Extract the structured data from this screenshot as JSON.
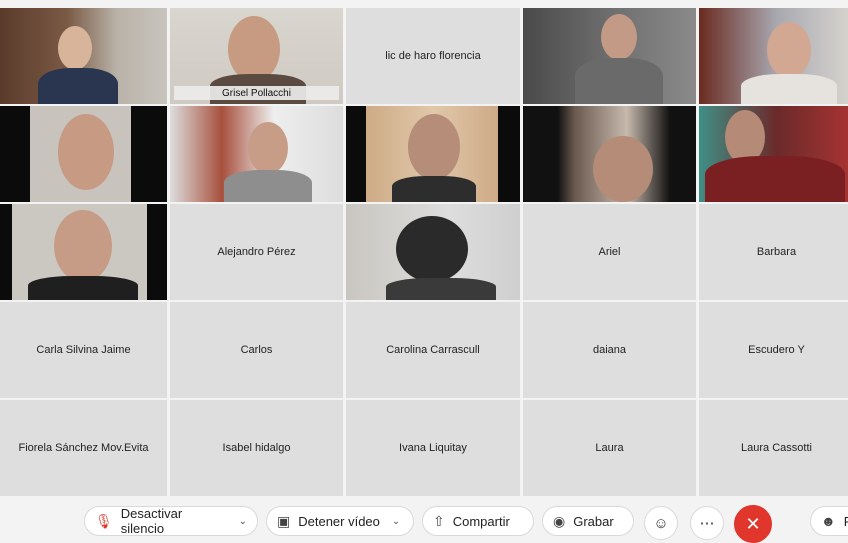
{
  "participants": [
    {
      "name": "",
      "video": true
    },
    {
      "name": "Grisel Pollacchi",
      "video": true,
      "active": true
    },
    {
      "name": "lic de haro florencia",
      "video": false
    },
    {
      "name": "",
      "video": true
    },
    {
      "name": "",
      "video": true
    },
    {
      "name": "",
      "video": true
    },
    {
      "name": "",
      "video": true
    },
    {
      "name": "",
      "video": true
    },
    {
      "name": "",
      "video": true
    },
    {
      "name": "",
      "video": true
    },
    {
      "name": "",
      "video": true
    },
    {
      "name": "Alejandro Pérez",
      "video": false
    },
    {
      "name": "",
      "video": true
    },
    {
      "name": "Ariel",
      "video": false
    },
    {
      "name": "Barbara",
      "video": false
    },
    {
      "name": "Carla Silvina Jaime",
      "video": false
    },
    {
      "name": "Carlos",
      "video": false
    },
    {
      "name": "Carolina Carrascull",
      "video": false
    },
    {
      "name": "daiana",
      "video": false
    },
    {
      "name": "Escudero Y",
      "video": false
    },
    {
      "name": "Fiorela Sánchez Mov.Evita",
      "video": false
    },
    {
      "name": "Isabel hidalgo",
      "video": false
    },
    {
      "name": "Ivana Liquitay",
      "video": false
    },
    {
      "name": "Laura",
      "video": false
    },
    {
      "name": "Laura Cassotti",
      "video": false
    }
  ],
  "toolbar": {
    "mute_label": "Desactivar silencio",
    "mute_icon": "mic-muted-icon",
    "video_label": "Detener vídeo",
    "video_icon": "camera-icon",
    "share_label": "Compartir",
    "share_icon": "share-icon",
    "record_label": "Grabar",
    "record_icon": "record-icon",
    "reactions_icon": "smiley-icon",
    "more_icon": "more-icon",
    "leave_icon": "close-icon",
    "participants_label": "P",
    "participants_icon": "person-icon"
  },
  "colors": {
    "active_border": "#3db5e6",
    "leave_button": "#e0362b",
    "tile_background": "#dedede"
  }
}
